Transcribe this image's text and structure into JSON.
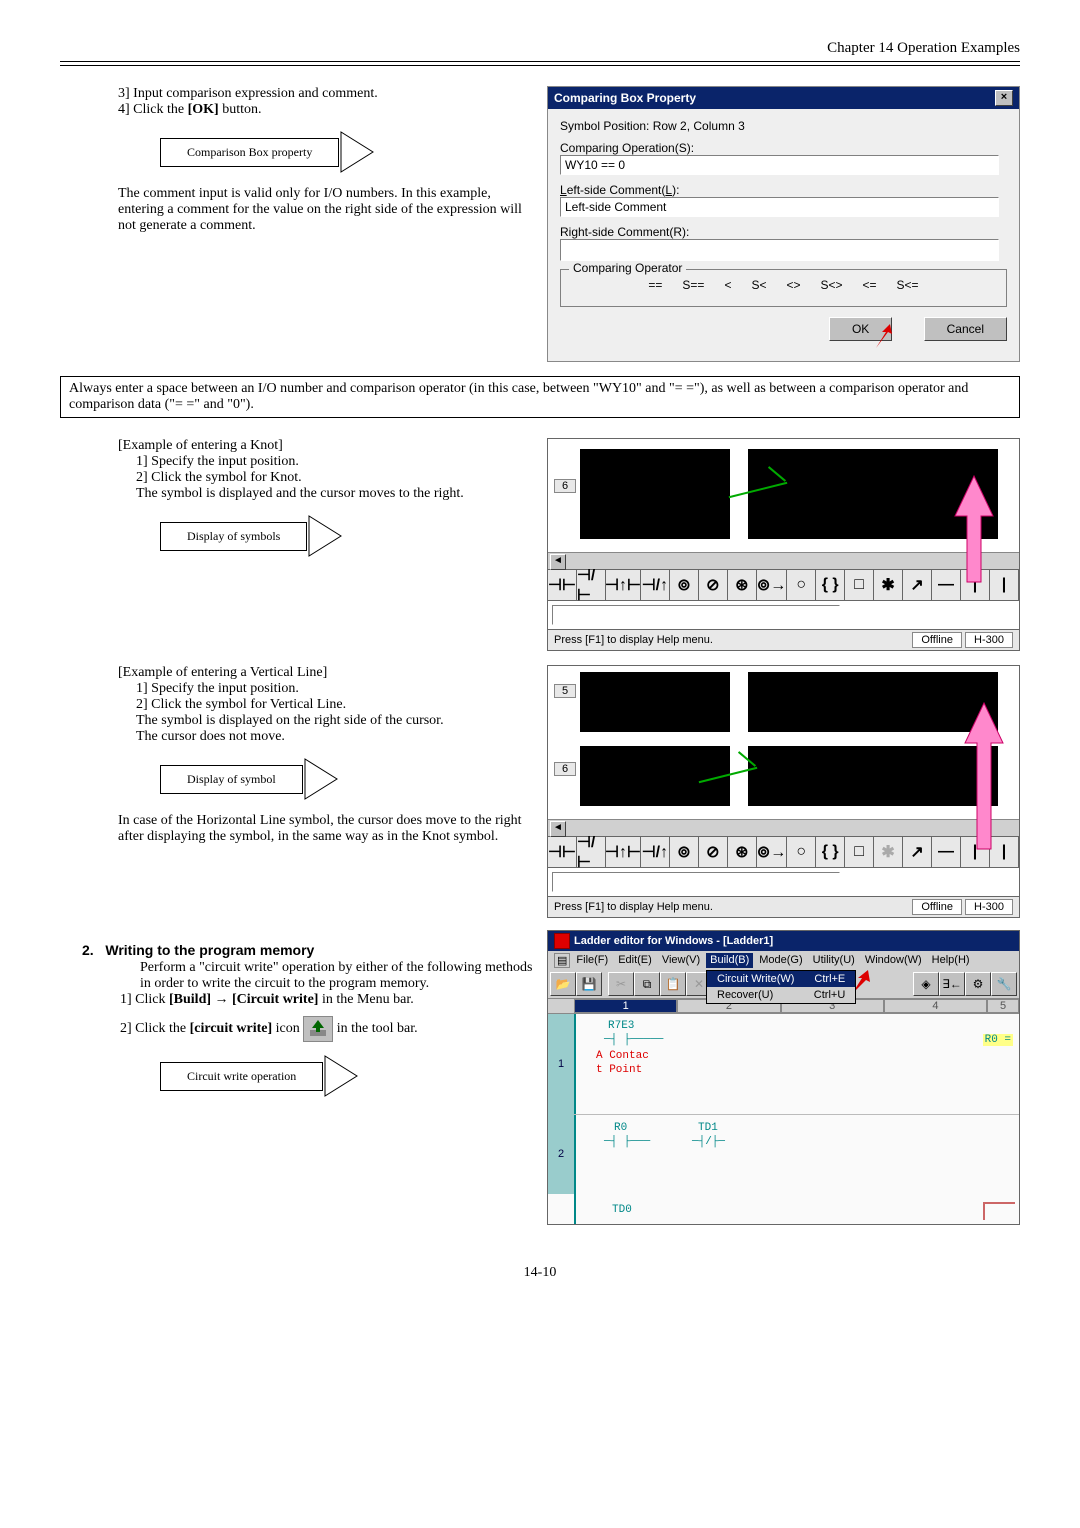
{
  "header": {
    "chapter": "Chapter 14  Operation Examples"
  },
  "steps_a": {
    "s3": "3]   Input comparison expression and comment.",
    "s4_a": "4]   Click the ",
    "s4_ok": "[OK]",
    "s4_b": " button."
  },
  "callout1": "Comparison Box property",
  "note1": "The comment input is valid only for I/O numbers. In this example, entering a comment for the value on the right side of the expression will not generate a comment.",
  "dialog": {
    "title": "Comparing Box Property",
    "pos": "Symbol Position:   Row 2, Column 3",
    "op_lbl": "Comparing Operation(S):",
    "op_val": "WY10 == 0",
    "left_lbl": "Left-side Comment(L):",
    "left_val": "Left-side Comment",
    "right_lbl": "Right-side Comment(R):",
    "right_val": "",
    "legend": "Comparing Operator",
    "ops": [
      "==",
      "S==",
      "<",
      "S<",
      "<>",
      "S<>",
      "<=",
      "S<="
    ],
    "ok": "OK",
    "cancel": "Cancel"
  },
  "always": "Always enter a space between an I/O number and comparison operator (in this case, between \"WY10\" and \"= =\"), as well as between a comparison operator and comparison data (\"= =\" and \"0\").",
  "knot": {
    "head": "[Example of entering a Knot]",
    "s1": "1]    Specify the input position.",
    "s2": "2]    Click the symbol for Knot.",
    "desc": "The symbol is displayed and the cursor moves to the right.",
    "callout": "Display of symbols"
  },
  "vline": {
    "head": "[Example of entering a Vertical Line]",
    "s1": "1]    Specify the input position.",
    "s2": "2]    Click the symbol for Vertical Line.",
    "desc": "The symbol is displayed on the right side of the cursor.",
    "desc2": "The cursor does not move.",
    "callout": "Display of symbol",
    "tail": "In case of the Horizontal Line symbol, the cursor does move to the right after displaying the symbol, in the same way as in the Knot symbol."
  },
  "shot": {
    "status": "Press [F1] to display Help menu.",
    "offline": "Offline",
    "model": "H-300",
    "row6": "6",
    "row5": "5",
    "tools": [
      "⊣⊢",
      "⊣/⊢",
      "⊣↑⊢",
      "⊣/↑",
      "⊚",
      "⊘",
      "⊛",
      "⊚→",
      "○",
      "{ }",
      "□",
      "✱",
      "↗",
      "—",
      "|",
      "|"
    ]
  },
  "section2": {
    "num": "2.",
    "title": "Writing to the program memory",
    "intro": "Perform a \"circuit write\" operation by either of the following methods in order to write the circuit to the program memory.",
    "s1a": "1]    Click ",
    "s1b": "[Build]",
    "s1c": " → ",
    "s1d": "[Circuit write]",
    "s1e": " in the Menu bar.",
    "s2a": "2]    Click the ",
    "s2b": "[circuit write]",
    "s2c": " icon ",
    "s2d": " in the tool bar.",
    "callout": "Circuit write operation"
  },
  "ladder": {
    "title": "Ladder editor for Windows - [Ladder1]",
    "menus": [
      "File(F)",
      "Edit(E)",
      "View(V)",
      "Build(B)",
      "Mode(G)",
      "Utility(U)",
      "Window(W)",
      "Help(H)"
    ],
    "dd": {
      "m1": "Circuit Write(W)",
      "k1": "Ctrl+E",
      "m2": "Recover(U)",
      "k2": "Ctrl+U"
    },
    "rung1": {
      "num": "1",
      "sym": "R7E3",
      "cmt1": "A Contac",
      "cmt2": "t Point",
      "out": "R0  ="
    },
    "rung2": {
      "num": "2",
      "r0": "R0",
      "td1": "TD1",
      "td0": "TD0"
    }
  },
  "pagenum": "14-10"
}
